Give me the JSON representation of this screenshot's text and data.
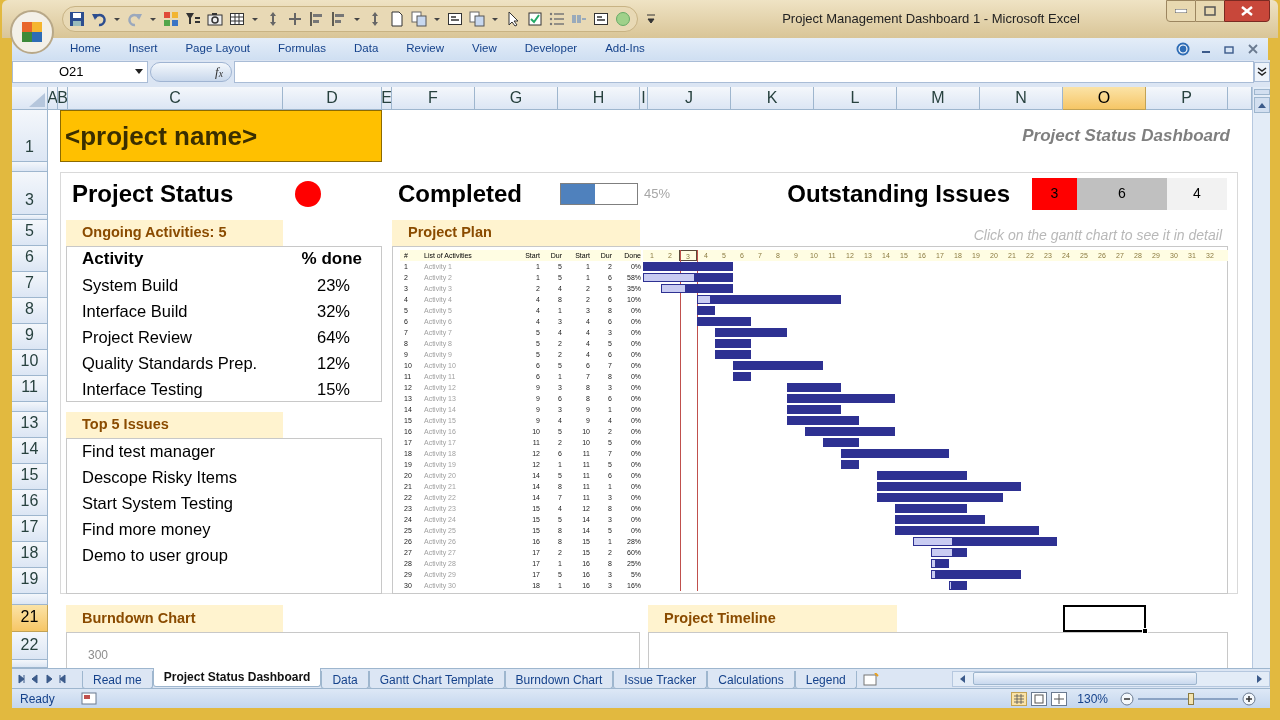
{
  "window": {
    "title": "Project Management Dashboard 1 - Microsoft Excel"
  },
  "ribbon_tabs": [
    "Home",
    "Insert",
    "Page Layout",
    "Formulas",
    "Data",
    "Review",
    "View",
    "Developer",
    "Add-Ins"
  ],
  "formula_bar": {
    "name_box": "O21",
    "function_button": "f$_{x}$"
  },
  "columns": [
    {
      "label": "A",
      "selected": false
    },
    {
      "label": "B",
      "selected": false
    },
    {
      "label": "C",
      "selected": false
    },
    {
      "label": "D",
      "selected": false
    },
    {
      "label": "E",
      "selected": false
    },
    {
      "label": "F",
      "selected": false
    },
    {
      "label": "G",
      "selected": false
    },
    {
      "label": "H",
      "selected": false
    },
    {
      "label": "I",
      "selected": false
    },
    {
      "label": "J",
      "selected": false
    },
    {
      "label": "K",
      "selected": false
    },
    {
      "label": "L",
      "selected": false
    },
    {
      "label": "M",
      "selected": false
    },
    {
      "label": "N",
      "selected": false
    },
    {
      "label": "O",
      "selected": true
    },
    {
      "label": "P",
      "selected": false
    }
  ],
  "rows": [
    {
      "label": "1",
      "selected": false
    },
    {
      "label": "3",
      "selected": false
    },
    {
      "label": "5",
      "selected": false
    },
    {
      "label": "6",
      "selected": false
    },
    {
      "label": "7",
      "selected": false
    },
    {
      "label": "8",
      "selected": false
    },
    {
      "label": "9",
      "selected": false
    },
    {
      "label": "10",
      "selected": false
    },
    {
      "label": "11",
      "selected": false
    },
    {
      "label": "13",
      "selected": false
    },
    {
      "label": "14",
      "selected": false
    },
    {
      "label": "15",
      "selected": false
    },
    {
      "label": "16",
      "selected": false
    },
    {
      "label": "17",
      "selected": false
    },
    {
      "label": "18",
      "selected": false
    },
    {
      "label": "19",
      "selected": false
    },
    {
      "label": "21",
      "selected": true
    },
    {
      "label": "22",
      "selected": false
    }
  ],
  "dashboard": {
    "project_name": "<project name>",
    "subtitle": "Project Status Dashboard",
    "status": {
      "label": "Project Status",
      "color": "#ff0000"
    },
    "completed": {
      "label": "Completed",
      "level": 0.45,
      "reading": "45%"
    },
    "outstanding_issues": {
      "label": "Outstanding Issues",
      "counts": [
        {
          "value": "3",
          "color": "#ff0000"
        },
        {
          "value": "6",
          "color": "#c0c0c0"
        },
        {
          "value": "4",
          "color": "#f2f2f2"
        }
      ]
    },
    "ongoing": {
      "title": "Ongoing Activities: 5",
      "columns": [
        "Activity",
        "% done"
      ],
      "rows": [
        [
          "System Build",
          "23%"
        ],
        [
          "Interface Build",
          "32%"
        ],
        [
          "Project Review",
          "64%"
        ],
        [
          "Quality Standards Prep.",
          "12%"
        ],
        [
          "Interface Testing",
          "15%"
        ]
      ]
    },
    "issues": {
      "title": "Top 5 Issues",
      "items": [
        "Find test manager",
        "Descope Risky Items",
        "Start System Testing",
        "Find more money",
        "Demo to user group"
      ]
    },
    "project_plan": {
      "title": "Project Plan",
      "hint": "Click on the gantt chart to see it in detail",
      "columns": [
        "#",
        "List of Activities",
        "Start",
        "Dur",
        "Start",
        "Dur",
        "Done"
      ],
      "days": [
        {
          "label": "1",
          "selected": false
        },
        {
          "label": "2",
          "selected": false
        },
        {
          "label": "3",
          "selected": true
        },
        {
          "label": "4",
          "selected": false
        },
        {
          "label": "5",
          "selected": false
        },
        {
          "label": "6",
          "selected": false
        },
        {
          "label": "7",
          "selected": false
        },
        {
          "label": "8",
          "selected": false
        },
        {
          "label": "9",
          "selected": false
        },
        {
          "label": "10",
          "selected": false
        },
        {
          "label": "11",
          "selected": false
        },
        {
          "label": "12",
          "selected": false
        },
        {
          "label": "13",
          "selected": false
        },
        {
          "label": "14",
          "selected": false
        },
        {
          "label": "15",
          "selected": false
        },
        {
          "label": "16",
          "selected": false
        },
        {
          "label": "17",
          "selected": false
        },
        {
          "label": "18",
          "selected": false
        },
        {
          "label": "19",
          "selected": false
        },
        {
          "label": "20",
          "selected": false
        },
        {
          "label": "21",
          "selected": false
        },
        {
          "label": "22",
          "selected": false
        },
        {
          "label": "23",
          "selected": false
        },
        {
          "label": "24",
          "selected": false
        },
        {
          "label": "25",
          "selected": false
        },
        {
          "label": "26",
          "selected": false
        },
        {
          "label": "27",
          "selected": false
        },
        {
          "label": "28",
          "selected": false
        },
        {
          "label": "29",
          "selected": false
        },
        {
          "label": "30",
          "selected": false
        },
        {
          "label": "31",
          "selected": false
        },
        {
          "label": "32",
          "selected": false
        }
      ],
      "rows": [
        {
          "n": "1",
          "activity": "Activity 1",
          "start": "1",
          "dur": "5",
          "start_2": "1",
          "dur_2": "2",
          "done": "0%"
        },
        {
          "n": "2",
          "activity": "Activity 2",
          "start": "1",
          "dur": "5",
          "start_2": "1",
          "dur_2": "6",
          "done": "58%"
        },
        {
          "n": "3",
          "activity": "Activity 3",
          "start": "2",
          "dur": "4",
          "start_2": "2",
          "dur_2": "5",
          "done": "35%"
        },
        {
          "n": "4",
          "activity": "Activity 4",
          "start": "4",
          "dur": "8",
          "start_2": "2",
          "dur_2": "6",
          "done": "10%"
        },
        {
          "n": "5",
          "activity": "Activity 5",
          "start": "4",
          "dur": "1",
          "start_2": "3",
          "dur_2": "8",
          "done": "0%"
        },
        {
          "n": "6",
          "activity": "Activity 6",
          "start": "4",
          "dur": "3",
          "start_2": "4",
          "dur_2": "6",
          "done": "0%"
        },
        {
          "n": "7",
          "activity": "Activity 7",
          "start": "5",
          "dur": "4",
          "start_2": "4",
          "dur_2": "3",
          "done": "0%"
        },
        {
          "n": "8",
          "activity": "Activity 8",
          "start": "5",
          "dur": "2",
          "start_2": "4",
          "dur_2": "5",
          "done": "0%"
        },
        {
          "n": "9",
          "activity": "Activity 9",
          "start": "5",
          "dur": "2",
          "start_2": "4",
          "dur_2": "6",
          "done": "0%"
        },
        {
          "n": "10",
          "activity": "Activity 10",
          "start": "6",
          "dur": "5",
          "start_2": "6",
          "dur_2": "7",
          "done": "0%"
        },
        {
          "n": "11",
          "activity": "Activity 11",
          "start": "6",
          "dur": "1",
          "start_2": "7",
          "dur_2": "8",
          "done": "0%"
        },
        {
          "n": "12",
          "activity": "Activity 12",
          "start": "9",
          "dur": "3",
          "start_2": "8",
          "dur_2": "3",
          "done": "0%"
        },
        {
          "n": "13",
          "activity": "Activity 13",
          "start": "9",
          "dur": "6",
          "start_2": "8",
          "dur_2": "6",
          "done": "0%"
        },
        {
          "n": "14",
          "activity": "Activity 14",
          "start": "9",
          "dur": "3",
          "start_2": "9",
          "dur_2": "1",
          "done": "0%"
        },
        {
          "n": "15",
          "activity": "Activity 15",
          "start": "9",
          "dur": "4",
          "start_2": "9",
          "dur_2": "4",
          "done": "0%"
        },
        {
          "n": "16",
          "activity": "Activity 16",
          "start": "10",
          "dur": "5",
          "start_2": "10",
          "dur_2": "2",
          "done": "0%"
        },
        {
          "n": "17",
          "activity": "Activity 17",
          "start": "11",
          "dur": "2",
          "start_2": "10",
          "dur_2": "5",
          "done": "0%"
        },
        {
          "n": "18",
          "activity": "Activity 18",
          "start": "12",
          "dur": "6",
          "start_2": "11",
          "dur_2": "7",
          "done": "0%"
        },
        {
          "n": "19",
          "activity": "Activity 19",
          "start": "12",
          "dur": "1",
          "start_2": "11",
          "dur_2": "5",
          "done": "0%"
        },
        {
          "n": "20",
          "activity": "Activity 20",
          "start": "14",
          "dur": "5",
          "start_2": "11",
          "dur_2": "6",
          "done": "0%"
        },
        {
          "n": "21",
          "activity": "Activity 21",
          "start": "14",
          "dur": "8",
          "start_2": "11",
          "dur_2": "1",
          "done": "0%"
        },
        {
          "n": "22",
          "activity": "Activity 22",
          "start": "14",
          "dur": "7",
          "start_2": "11",
          "dur_2": "3",
          "done": "0%"
        },
        {
          "n": "23",
          "activity": "Activity 23",
          "start": "15",
          "dur": "4",
          "start_2": "12",
          "dur_2": "8",
          "done": "0%"
        },
        {
          "n": "24",
          "activity": "Activity 24",
          "start": "15",
          "dur": "5",
          "start_2": "14",
          "dur_2": "3",
          "done": "0%"
        },
        {
          "n": "25",
          "activity": "Activity 25",
          "start": "15",
          "dur": "8",
          "start_2": "14",
          "dur_2": "5",
          "done": "0%"
        },
        {
          "n": "26",
          "activity": "Activity 26",
          "start": "16",
          "dur": "8",
          "start_2": "15",
          "dur_2": "1",
          "done": "28%"
        },
        {
          "n": "27",
          "activity": "Activity 27",
          "start": "17",
          "dur": "2",
          "start_2": "15",
          "dur_2": "2",
          "done": "60%"
        },
        {
          "n": "28",
          "activity": "Activity 28",
          "start": "17",
          "dur": "1",
          "start_2": "16",
          "dur_2": "8",
          "done": "25%"
        },
        {
          "n": "29",
          "activity": "Activity 29",
          "start": "17",
          "dur": "5",
          "start_2": "16",
          "dur_2": "3",
          "done": "5%"
        },
        {
          "n": "30",
          "activity": "Activity 30",
          "start": "18",
          "dur": "1",
          "start_2": "16",
          "dur_2": "3",
          "done": "16%"
        }
      ]
    },
    "burndown": {
      "title": "Burndown Chart",
      "axis_label": "300"
    },
    "timeline": {
      "title": "Project Timeline"
    }
  },
  "sheet_tabs": [
    {
      "label": "Read me",
      "selected": false
    },
    {
      "label": "Project Status Dashboard",
      "selected": true
    },
    {
      "label": "Data",
      "selected": false
    },
    {
      "label": "Gantt Chart Template",
      "selected": false
    },
    {
      "label": "Burndown Chart",
      "selected": false
    },
    {
      "label": "Issue Tracker",
      "selected": false
    },
    {
      "label": "Calculations",
      "selected": false
    },
    {
      "label": "Legend",
      "selected": false
    }
  ],
  "status_bar": {
    "text": "Ready",
    "zoom": "130%",
    "zoom_slider": {
      "level": 0.53
    }
  }
}
